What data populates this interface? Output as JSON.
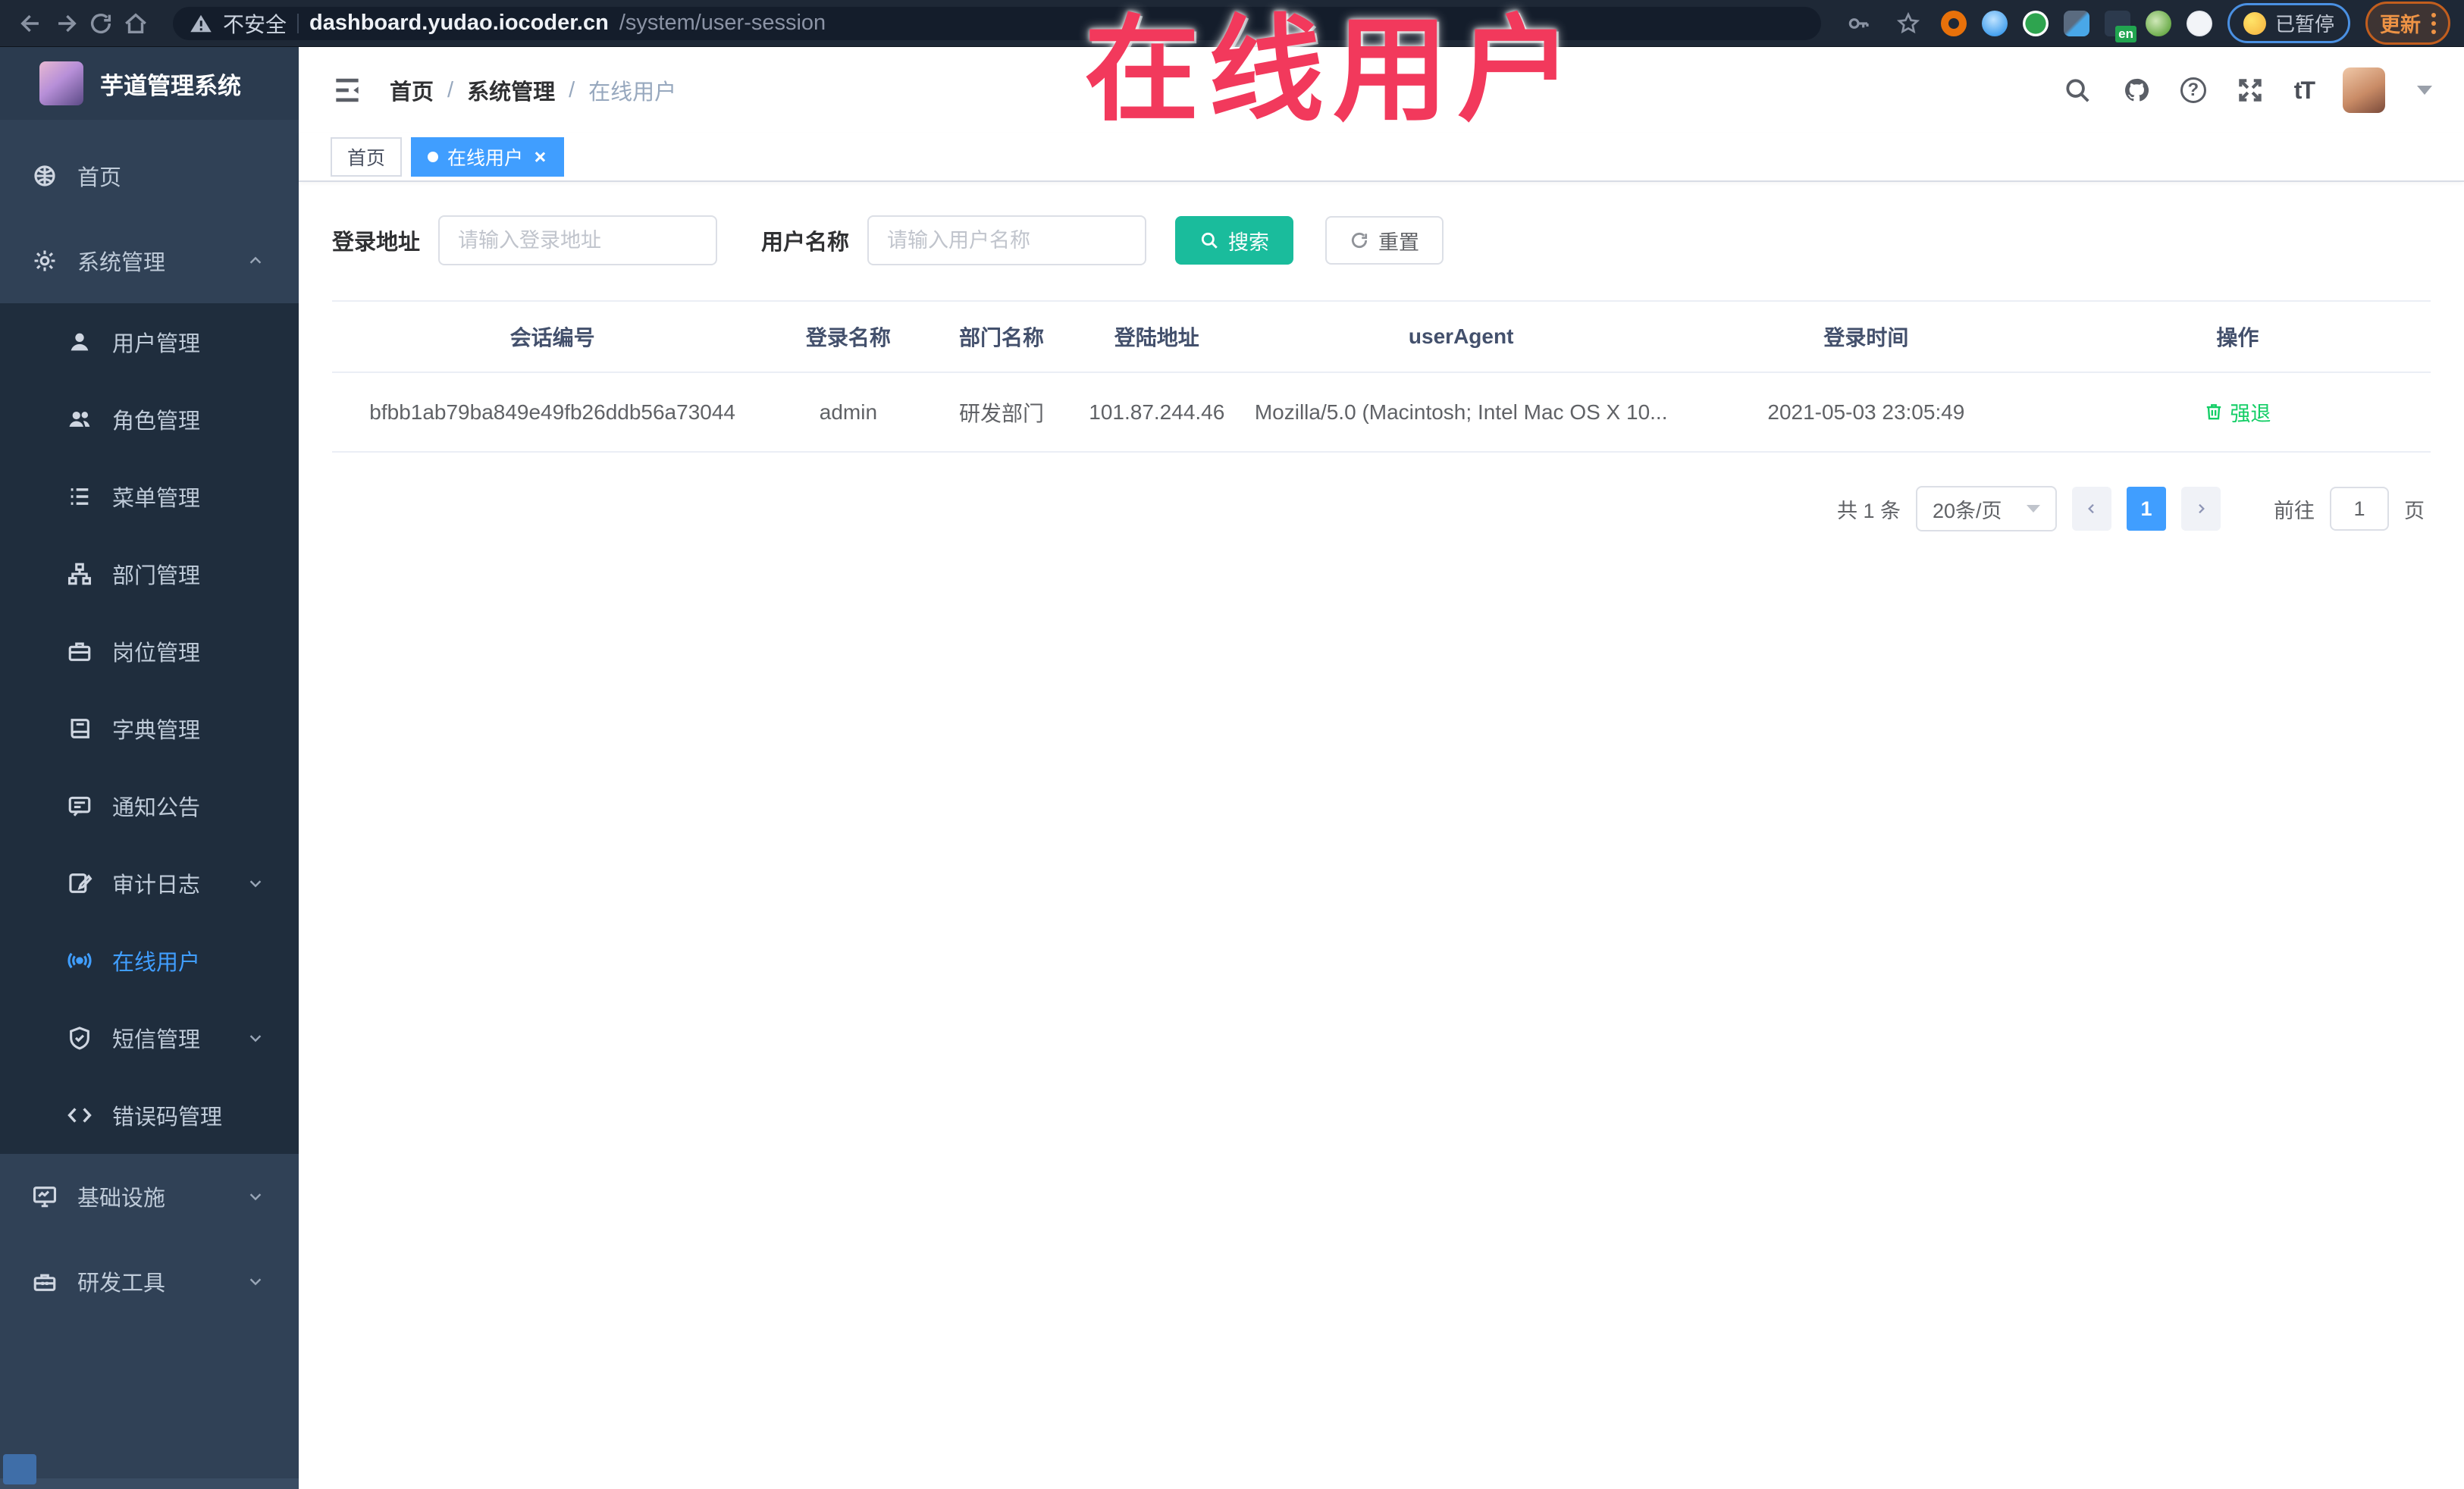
{
  "browser": {
    "warning_text": "不安全",
    "url_host": "dashboard.yudao.iocoder.cn",
    "url_path": "/system/user-session",
    "ext_badge": "en",
    "paused_label": "已暂停",
    "update_label": "更新"
  },
  "annotation": {
    "text": "在线用户"
  },
  "sidebar": {
    "title": "芋道管理系统",
    "items": [
      {
        "label": "首页"
      },
      {
        "label": "系统管理"
      },
      {
        "label": "用户管理"
      },
      {
        "label": "角色管理"
      },
      {
        "label": "菜单管理"
      },
      {
        "label": "部门管理"
      },
      {
        "label": "岗位管理"
      },
      {
        "label": "字典管理"
      },
      {
        "label": "通知公告"
      },
      {
        "label": "审计日志"
      },
      {
        "label": "在线用户"
      },
      {
        "label": "短信管理"
      },
      {
        "label": "错误码管理"
      },
      {
        "label": "基础设施"
      },
      {
        "label": "研发工具"
      }
    ]
  },
  "breadcrumb": {
    "items": [
      "首页",
      "系统管理",
      "在线用户"
    ],
    "separator": "/"
  },
  "header_icons": {
    "question_glyph": "?",
    "text_size_glyph": "tT"
  },
  "tags": {
    "home": "首页",
    "active": "在线用户"
  },
  "filters": {
    "address_label": "登录地址",
    "address_placeholder": "请输入登录地址",
    "name_label": "用户名称",
    "name_placeholder": "请输入用户名称",
    "search": "搜索",
    "reset": "重置"
  },
  "table": {
    "columns": [
      "会话编号",
      "登录名称",
      "部门名称",
      "登陆地址",
      "userAgent",
      "登录时间",
      "操作"
    ],
    "rows": [
      {
        "session": "bfbb1ab79ba849e49fb26ddb56a73044",
        "login_name": "admin",
        "dept": "研发部门",
        "ip": "101.87.244.46",
        "user_agent": "Mozilla/5.0 (Macintosh; Intel Mac OS X 10...",
        "time": "2021-05-03 23:05:49",
        "action": "强退"
      }
    ]
  },
  "pagination": {
    "total": "共 1 条",
    "page_size": "20条/页",
    "page": "1",
    "goto": "前往",
    "goto_value": "1",
    "unit": "页"
  },
  "colors": {
    "accent_blue": "#409eff",
    "search_teal": "#1abc9c",
    "action_green": "#13ce66",
    "annotation_red": "#f2395c"
  }
}
